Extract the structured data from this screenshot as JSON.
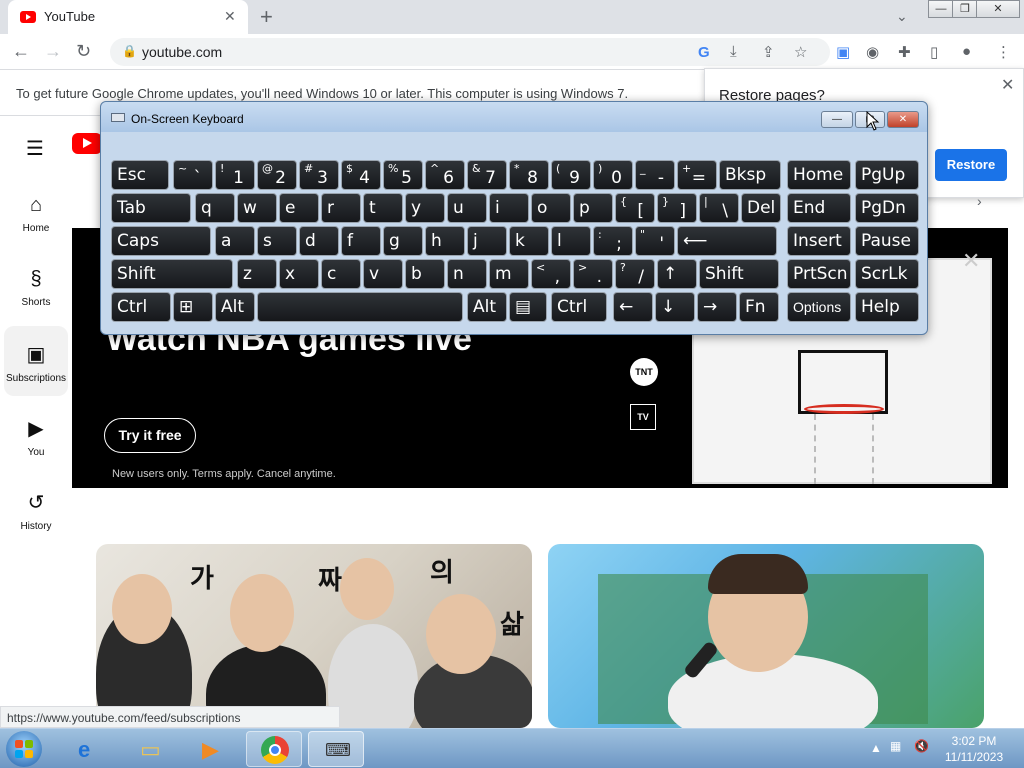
{
  "browser": {
    "tab_title": "YouTube",
    "tab_close": "✕",
    "new_tab": "+",
    "url": "youtube.com",
    "infobar_text": "To get future Google Chrome updates, you'll need Windows 10 or later. This computer is using Windows 7.",
    "restore_title": "Restore pages?",
    "restore_button": "Restore",
    "status_url": "https://www.youtube.com/feed/subscriptions"
  },
  "sidebar": {
    "items": [
      {
        "label": "Home",
        "icon": "home-icon"
      },
      {
        "label": "Shorts",
        "icon": "shorts-icon"
      },
      {
        "label": "Subscriptions",
        "icon": "subscriptions-icon"
      },
      {
        "label": "You",
        "icon": "you-icon"
      },
      {
        "label": "History",
        "icon": "history-icon"
      }
    ]
  },
  "banner": {
    "headline": "Watch NBA games live",
    "cta": "Try it free",
    "terms": "New users only. Terms apply. Cancel anytime.",
    "network_logo": "TNT",
    "league_logo": "TV"
  },
  "thumbnails": {
    "thumb1_chars": [
      "가",
      "짜",
      "의",
      "삶"
    ]
  },
  "osk": {
    "title": "On-Screen Keyboard",
    "rows": [
      [
        {
          "main": "Esc"
        },
        {
          "shift": "~",
          "low": "`"
        },
        {
          "shift": "!",
          "low": "1"
        },
        {
          "shift": "@",
          "low": "2"
        },
        {
          "shift": "#",
          "low": "3"
        },
        {
          "shift": "$",
          "low": "4"
        },
        {
          "shift": "%",
          "low": "5"
        },
        {
          "shift": "^",
          "low": "6"
        },
        {
          "shift": "&",
          "low": "7"
        },
        {
          "shift": "*",
          "low": "8"
        },
        {
          "shift": "(",
          "low": "9"
        },
        {
          "shift": ")",
          "low": "0"
        },
        {
          "shift": "_",
          "low": "-"
        },
        {
          "shift": "+",
          "low": "="
        },
        {
          "main": "Bksp"
        },
        {
          "main": "Home"
        },
        {
          "main": "PgUp"
        }
      ],
      [
        {
          "main": "Tab"
        },
        {
          "main": "q"
        },
        {
          "main": "w"
        },
        {
          "main": "e"
        },
        {
          "main": "r"
        },
        {
          "main": "t"
        },
        {
          "main": "y"
        },
        {
          "main": "u"
        },
        {
          "main": "i"
        },
        {
          "main": "o"
        },
        {
          "main": "p"
        },
        {
          "shift": "{",
          "low": "["
        },
        {
          "shift": "}",
          "low": "]"
        },
        {
          "shift": "|",
          "low": "\\"
        },
        {
          "main": "Del"
        },
        {
          "main": "End"
        },
        {
          "main": "PgDn"
        }
      ],
      [
        {
          "main": "Caps"
        },
        {
          "main": "a"
        },
        {
          "main": "s"
        },
        {
          "main": "d"
        },
        {
          "main": "f"
        },
        {
          "main": "g"
        },
        {
          "main": "h"
        },
        {
          "main": "j"
        },
        {
          "main": "k"
        },
        {
          "main": "l"
        },
        {
          "shift": ":",
          "low": ";"
        },
        {
          "shift": "\"",
          "low": "'"
        },
        {
          "main": "⟵"
        },
        {
          "main": "Insert"
        },
        {
          "main": "Pause"
        }
      ],
      [
        {
          "main": "Shift"
        },
        {
          "main": "z"
        },
        {
          "main": "x"
        },
        {
          "main": "c"
        },
        {
          "main": "v"
        },
        {
          "main": "b"
        },
        {
          "main": "n"
        },
        {
          "main": "m"
        },
        {
          "shift": "<",
          "low": ","
        },
        {
          "shift": ">",
          "low": "."
        },
        {
          "shift": "?",
          "low": "/"
        },
        {
          "main": "↑"
        },
        {
          "main": "Shift"
        },
        {
          "main": "PrtScn"
        },
        {
          "main": "ScrLk"
        }
      ],
      [
        {
          "main": "Ctrl"
        },
        {
          "main": "⊞"
        },
        {
          "main": "Alt"
        },
        {
          "main": ""
        },
        {
          "main": "Alt"
        },
        {
          "main": "▤"
        },
        {
          "main": "Ctrl"
        },
        {
          "main": "←"
        },
        {
          "main": "↓"
        },
        {
          "main": "→"
        },
        {
          "main": "Fn"
        },
        {
          "main": "Options",
          "small": true
        },
        {
          "main": "Help"
        }
      ]
    ]
  },
  "taskbar": {
    "time": "3:02 PM",
    "date": "11/11/2023",
    "apps": [
      "ie-icon",
      "explorer-icon",
      "media-player-icon",
      "chrome-icon",
      "osk-icon"
    ]
  }
}
